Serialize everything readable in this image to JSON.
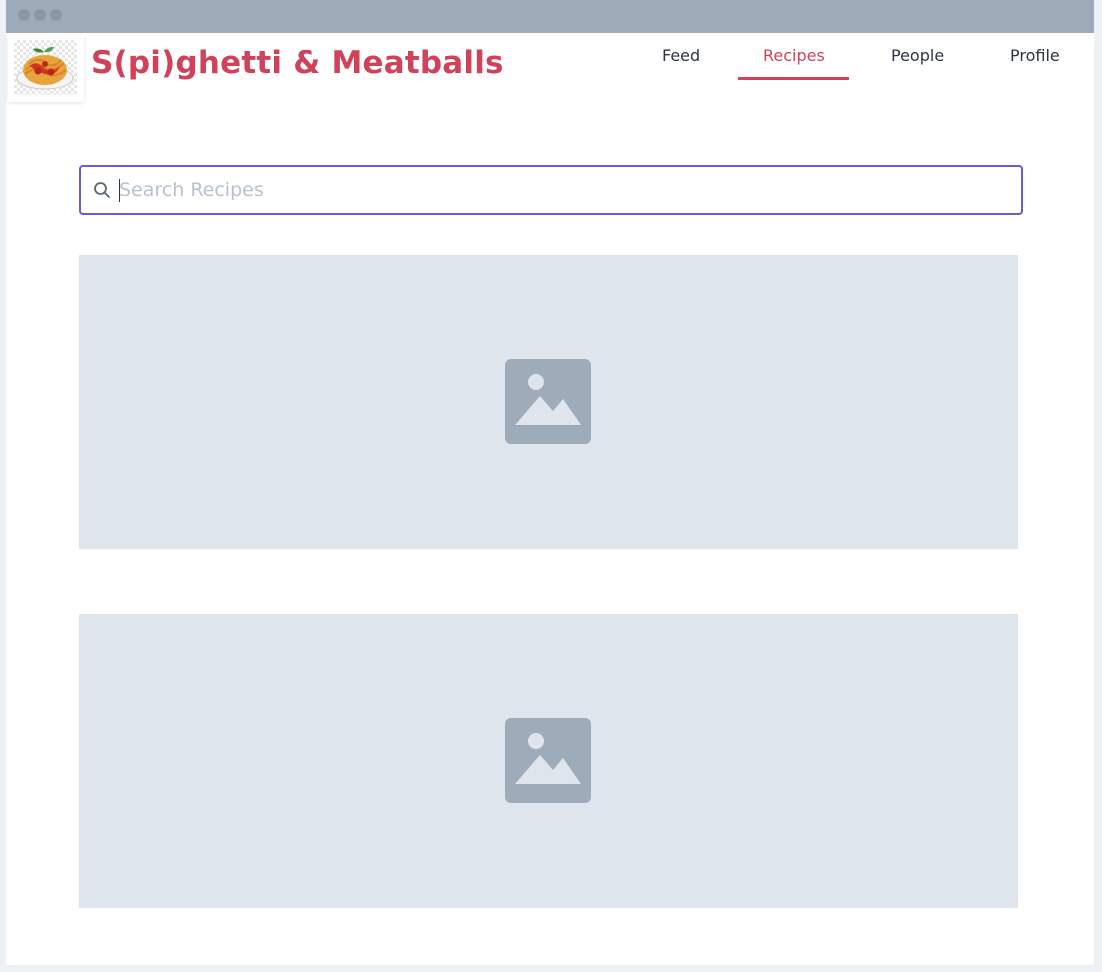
{
  "app": {
    "title": "S(pi)ghetti & Meatballs"
  },
  "nav": {
    "items": [
      {
        "label": "Feed",
        "active": false
      },
      {
        "label": "Recipes",
        "active": true
      },
      {
        "label": "People",
        "active": false
      },
      {
        "label": "Profile",
        "active": false
      }
    ]
  },
  "search": {
    "value": "",
    "placeholder": "Search Recipes"
  },
  "cards": [
    {
      "icon": "image-placeholder-icon"
    },
    {
      "icon": "image-placeholder-icon"
    }
  ],
  "colors": {
    "accent": "#d0425a",
    "focus_border": "#6c5bd0",
    "card_bg": "#dfe5ed",
    "placeholder_icon": "#9eacba",
    "titlebar": "#9eacba"
  }
}
